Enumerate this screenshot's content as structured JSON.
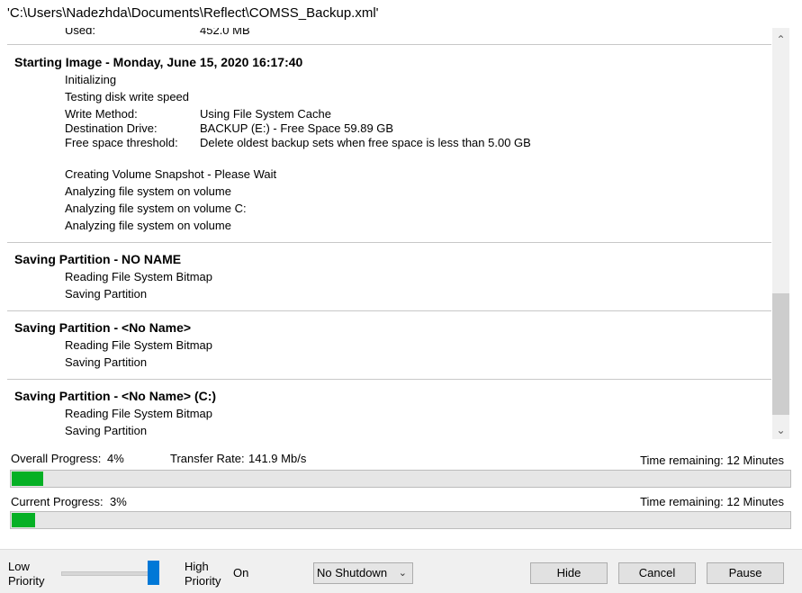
{
  "window": {
    "title": "'C:\\Users\\Nadezhda\\Documents\\Reflect\\COMSS_Backup.xml'"
  },
  "log": {
    "prev_label": "Used:",
    "prev_value": "452.0 MB",
    "starting_image_heading": "Starting Image - Monday, June 15, 2020 16:17:40",
    "initializing": "Initializing",
    "testing_speed": "Testing disk write speed",
    "write_method_label": "Write Method:",
    "write_method_value": "Using File System Cache",
    "destination_label": "Destination Drive:",
    "destination_value": "BACKUP (E:) - Free Space 59.89 GB",
    "threshold_label": "Free space threshold:",
    "threshold_value": "Delete oldest backup sets when free space is less than 5.00 GB",
    "snapshot": "Creating Volume Snapshot - Please Wait",
    "analyzing1": "Analyzing file system on volume",
    "analyzing2": "Analyzing file system on volume C:",
    "analyzing3": "Analyzing file system on volume",
    "section1_heading": "Saving Partition - NO NAME",
    "section1_line1": "Reading File System Bitmap",
    "section1_line2": "Saving Partition",
    "section2_heading": "Saving Partition - <No Name>",
    "section2_line1": "Reading File System Bitmap",
    "section2_line2": "Saving Partition",
    "section3_heading": "Saving Partition - <No Name> (C:)",
    "section3_line1": "Reading File System Bitmap",
    "section3_line2": "Saving Partition"
  },
  "scrollbar": {
    "up_icon": "chevron-up-icon",
    "down_icon": "chevron-down-icon"
  },
  "progress": {
    "overall_label": "Overall Progress:",
    "overall_value": "4%",
    "overall_fraction": 0.04,
    "transfer_label": "Transfer Rate:",
    "transfer_value": "141.9 Mb/s",
    "overall_time": "Time remaining: 12 Minutes",
    "current_label": "Current Progress:",
    "current_value": "3%",
    "current_fraction": 0.03,
    "current_time": "Time remaining: 12 Minutes",
    "fill_color": "#06b025"
  },
  "footer": {
    "low_priority": "Low Priority",
    "high_priority": "High Priority",
    "priority_level": 1.0,
    "on_label": "On",
    "shutdown_option": "No Shutdown",
    "hide_button": "Hide",
    "cancel_button": "Cancel",
    "pause_button": "Pause",
    "accent_color": "#0078d7"
  }
}
